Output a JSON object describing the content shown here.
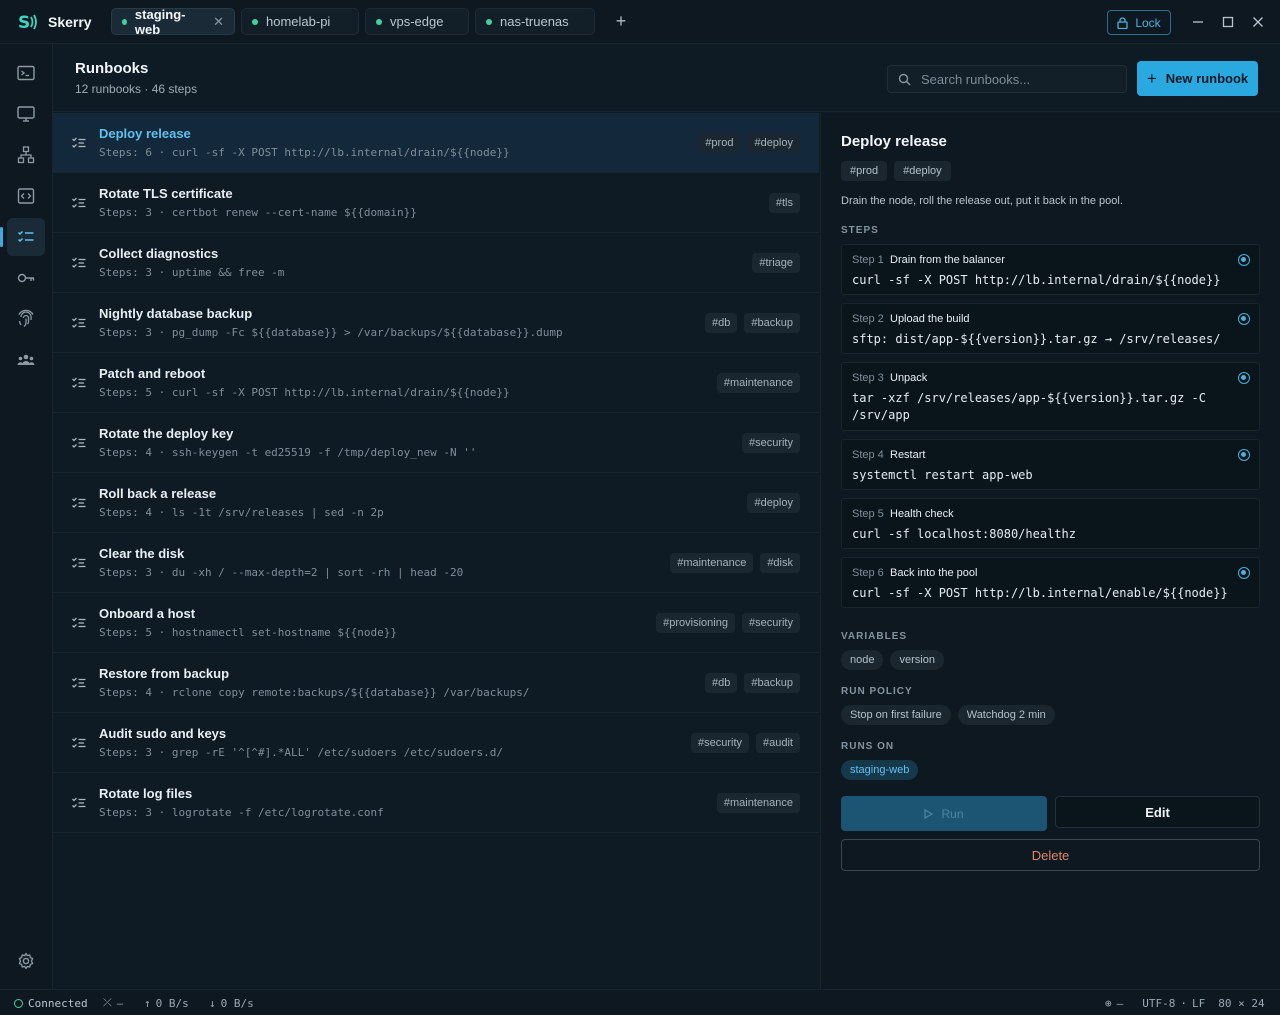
{
  "app": {
    "name": "Skerry"
  },
  "tabs": [
    {
      "label": "staging-web",
      "active": true
    },
    {
      "label": "homelab-pi",
      "active": false
    },
    {
      "label": "vps-edge",
      "active": false
    },
    {
      "label": "nas-truenas",
      "active": false
    }
  ],
  "titlebar": {
    "lock_label": "Lock"
  },
  "header": {
    "title": "Runbooks",
    "subtitle": "12 runbooks · 46 steps",
    "search_placeholder": "Search runbooks...",
    "new_label": "New runbook"
  },
  "runbooks": [
    {
      "name": "Deploy release",
      "meta": "Steps: 6 · curl -sf -X POST http://lb.internal/drain/${{node}}",
      "tags": [
        "#prod",
        "#deploy"
      ]
    },
    {
      "name": "Rotate TLS certificate",
      "meta": "Steps: 3 · certbot renew --cert-name ${{domain}}",
      "tags": [
        "#tls"
      ]
    },
    {
      "name": "Collect diagnostics",
      "meta": "Steps: 3 · uptime && free -m",
      "tags": [
        "#triage"
      ]
    },
    {
      "name": "Nightly database backup",
      "meta": "Steps: 3 · pg_dump -Fc ${{database}} > /var/backups/${{database}}.dump",
      "tags": [
        "#db",
        "#backup"
      ]
    },
    {
      "name": "Patch and reboot",
      "meta": "Steps: 5 · curl -sf -X POST http://lb.internal/drain/${{node}}",
      "tags": [
        "#maintenance"
      ]
    },
    {
      "name": "Rotate the deploy key",
      "meta": "Steps: 4 · ssh-keygen -t ed25519 -f /tmp/deploy_new -N ''",
      "tags": [
        "#security"
      ]
    },
    {
      "name": "Roll back a release",
      "meta": "Steps: 4 · ls -1t /srv/releases | sed -n 2p",
      "tags": [
        "#deploy"
      ]
    },
    {
      "name": "Clear the disk",
      "meta": "Steps: 3 · du -xh / --max-depth=2 | sort -rh | head -20",
      "tags": [
        "#maintenance",
        "#disk"
      ]
    },
    {
      "name": "Onboard a host",
      "meta": "Steps: 5 · hostnamectl set-hostname ${{node}}",
      "tags": [
        "#provisioning",
        "#security"
      ]
    },
    {
      "name": "Restore from backup",
      "meta": "Steps: 4 · rclone copy remote:backups/${{database}} /var/backups/",
      "tags": [
        "#db",
        "#backup"
      ]
    },
    {
      "name": "Audit sudo and keys",
      "meta": "Steps: 3 · grep -rE '^[^#].*ALL' /etc/sudoers /etc/sudoers.d/",
      "tags": [
        "#security",
        "#audit"
      ]
    },
    {
      "name": "Rotate log files",
      "meta": "Steps: 3 · logrotate -f /etc/logrotate.conf",
      "tags": [
        "#maintenance"
      ]
    }
  ],
  "detail": {
    "title": "Deploy release",
    "tags": [
      "#prod",
      "#deploy"
    ],
    "description": "Drain the node, roll the release out, put it back in the pool.",
    "steps_label": "STEPS",
    "steps": [
      {
        "num": "Step 1",
        "title": "Drain from the balancer",
        "cmd": "curl -sf -X POST http://lb.internal/drain/${{node}}",
        "has_icon": true
      },
      {
        "num": "Step 2",
        "title": "Upload the build",
        "cmd": "sftp: dist/app-${{version}}.tar.gz → /srv/releases/",
        "has_icon": true
      },
      {
        "num": "Step 3",
        "title": "Unpack",
        "cmd": "tar -xzf /srv/releases/app-${{version}}.tar.gz -C /srv/app",
        "has_icon": true
      },
      {
        "num": "Step 4",
        "title": "Restart",
        "cmd": "systemctl restart app-web",
        "has_icon": true
      },
      {
        "num": "Step 5",
        "title": "Health check",
        "cmd": "curl -sf localhost:8080/healthz",
        "has_icon": false
      },
      {
        "num": "Step 6",
        "title": "Back into the pool",
        "cmd": "curl -sf -X POST http://lb.internal/enable/${{node}}",
        "has_icon": true
      }
    ],
    "variables_label": "VARIABLES",
    "variables": [
      "node",
      "version"
    ],
    "run_policy_label": "RUN POLICY",
    "run_policy": [
      "Stop on first failure",
      "Watchdog 2 min"
    ],
    "runs_on_label": "RUNS ON",
    "runs_on": [
      "staging-web"
    ],
    "run_label": "Run",
    "edit_label": "Edit",
    "delete_label": "Delete"
  },
  "statusbar": {
    "connection": "Connected",
    "branch": "–",
    "upload": "0 B/s",
    "download": "0 B/s",
    "globe": "–",
    "encoding": "UTF-8",
    "line_ending": "LF",
    "size": "80 × 24"
  },
  "colors": {
    "accent": "#2aa8e0",
    "brand": "#3fd3c1",
    "danger": "#e38664",
    "online": "#3fd3a0"
  }
}
